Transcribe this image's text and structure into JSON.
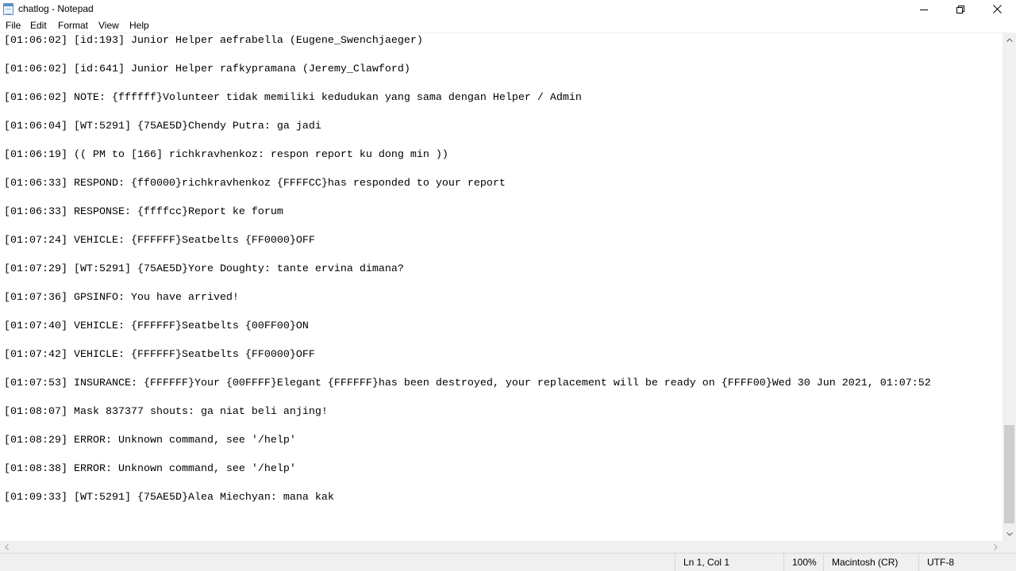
{
  "window": {
    "title": "chatlog - Notepad"
  },
  "menu": {
    "file": "File",
    "edit": "Edit",
    "format": "Format",
    "view": "View",
    "help": "Help"
  },
  "editor": {
    "lines": [
      "[01:06:02] [id:193] Junior Helper aefrabella (Eugene_Swenchjaeger)",
      "[01:06:02] [id:641] Junior Helper rafkypramana (Jeremy_Clawford)",
      "[01:06:02] NOTE: {ffffff}Volunteer tidak memiliki kedudukan yang sama dengan Helper / Admin",
      "[01:06:04] [WT:5291] {75AE5D}Chendy Putra: ga jadi",
      "[01:06:19] (( PM to [166] richkravhenkoz: respon report ku dong min ))",
      "[01:06:33] RESPOND: {ff0000}richkravhenkoz {FFFFCC}has responded to your report",
      "[01:06:33] RESPONSE: {ffffcc}Report ke forum",
      "[01:07:24] VEHICLE: {FFFFFF}Seatbelts {FF0000}OFF",
      "[01:07:29] [WT:5291] {75AE5D}Yore Doughty: tante ervina dimana?",
      "[01:07:36] GPSINFO: You have arrived!",
      "[01:07:40] VEHICLE: {FFFFFF}Seatbelts {00FF00}ON",
      "[01:07:42] VEHICLE: {FFFFFF}Seatbelts {FF0000}OFF",
      "[01:07:53] INSURANCE: {FFFFFF}Your {00FFFF}Elegant {FFFFFF}has been destroyed, your replacement will be ready on {FFFF00}Wed 30 Jun 2021, 01:07:52",
      "[01:08:07] Mask 837377 shouts: ga niat beli anjing!",
      "[01:08:29] ERROR: Unknown command, see '/help'",
      "[01:08:38] ERROR: Unknown command, see '/help'",
      "[01:09:33] [WT:5291] {75AE5D}Alea Miechyan: mana kak"
    ]
  },
  "status": {
    "position": "Ln 1, Col 1",
    "zoom": "100%",
    "line_ending": "Macintosh (CR)",
    "encoding": "UTF-8"
  },
  "icons": {
    "app": "notepad-icon",
    "minimize": "minimize-icon",
    "maximize": "restore-icon",
    "close": "close-icon"
  }
}
